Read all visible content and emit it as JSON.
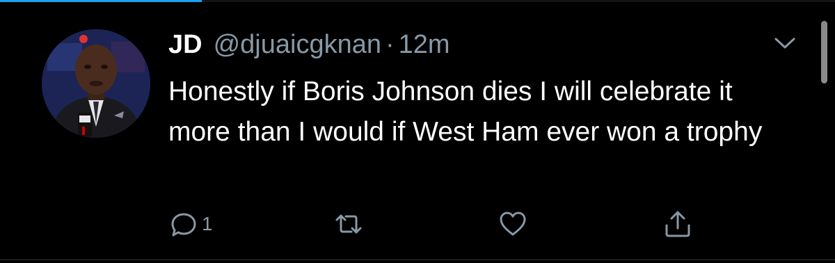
{
  "tweet": {
    "display_name": "JD",
    "handle": "@djuaicgknan",
    "separator": "·",
    "time": "12m",
    "text": "Honestly if Boris Johnson dies I will celebrate it more than I would if West Ham ever won a trophy",
    "reply_count": "1"
  },
  "icons": {
    "menu": "chevron-down-icon",
    "reply": "reply-icon",
    "retweet": "retweet-icon",
    "like": "heart-icon",
    "share": "share-icon"
  },
  "colors": {
    "background": "#000000",
    "primary_text": "#ffffff",
    "secondary_text": "#8899a6",
    "accent": "#1da1f2"
  }
}
